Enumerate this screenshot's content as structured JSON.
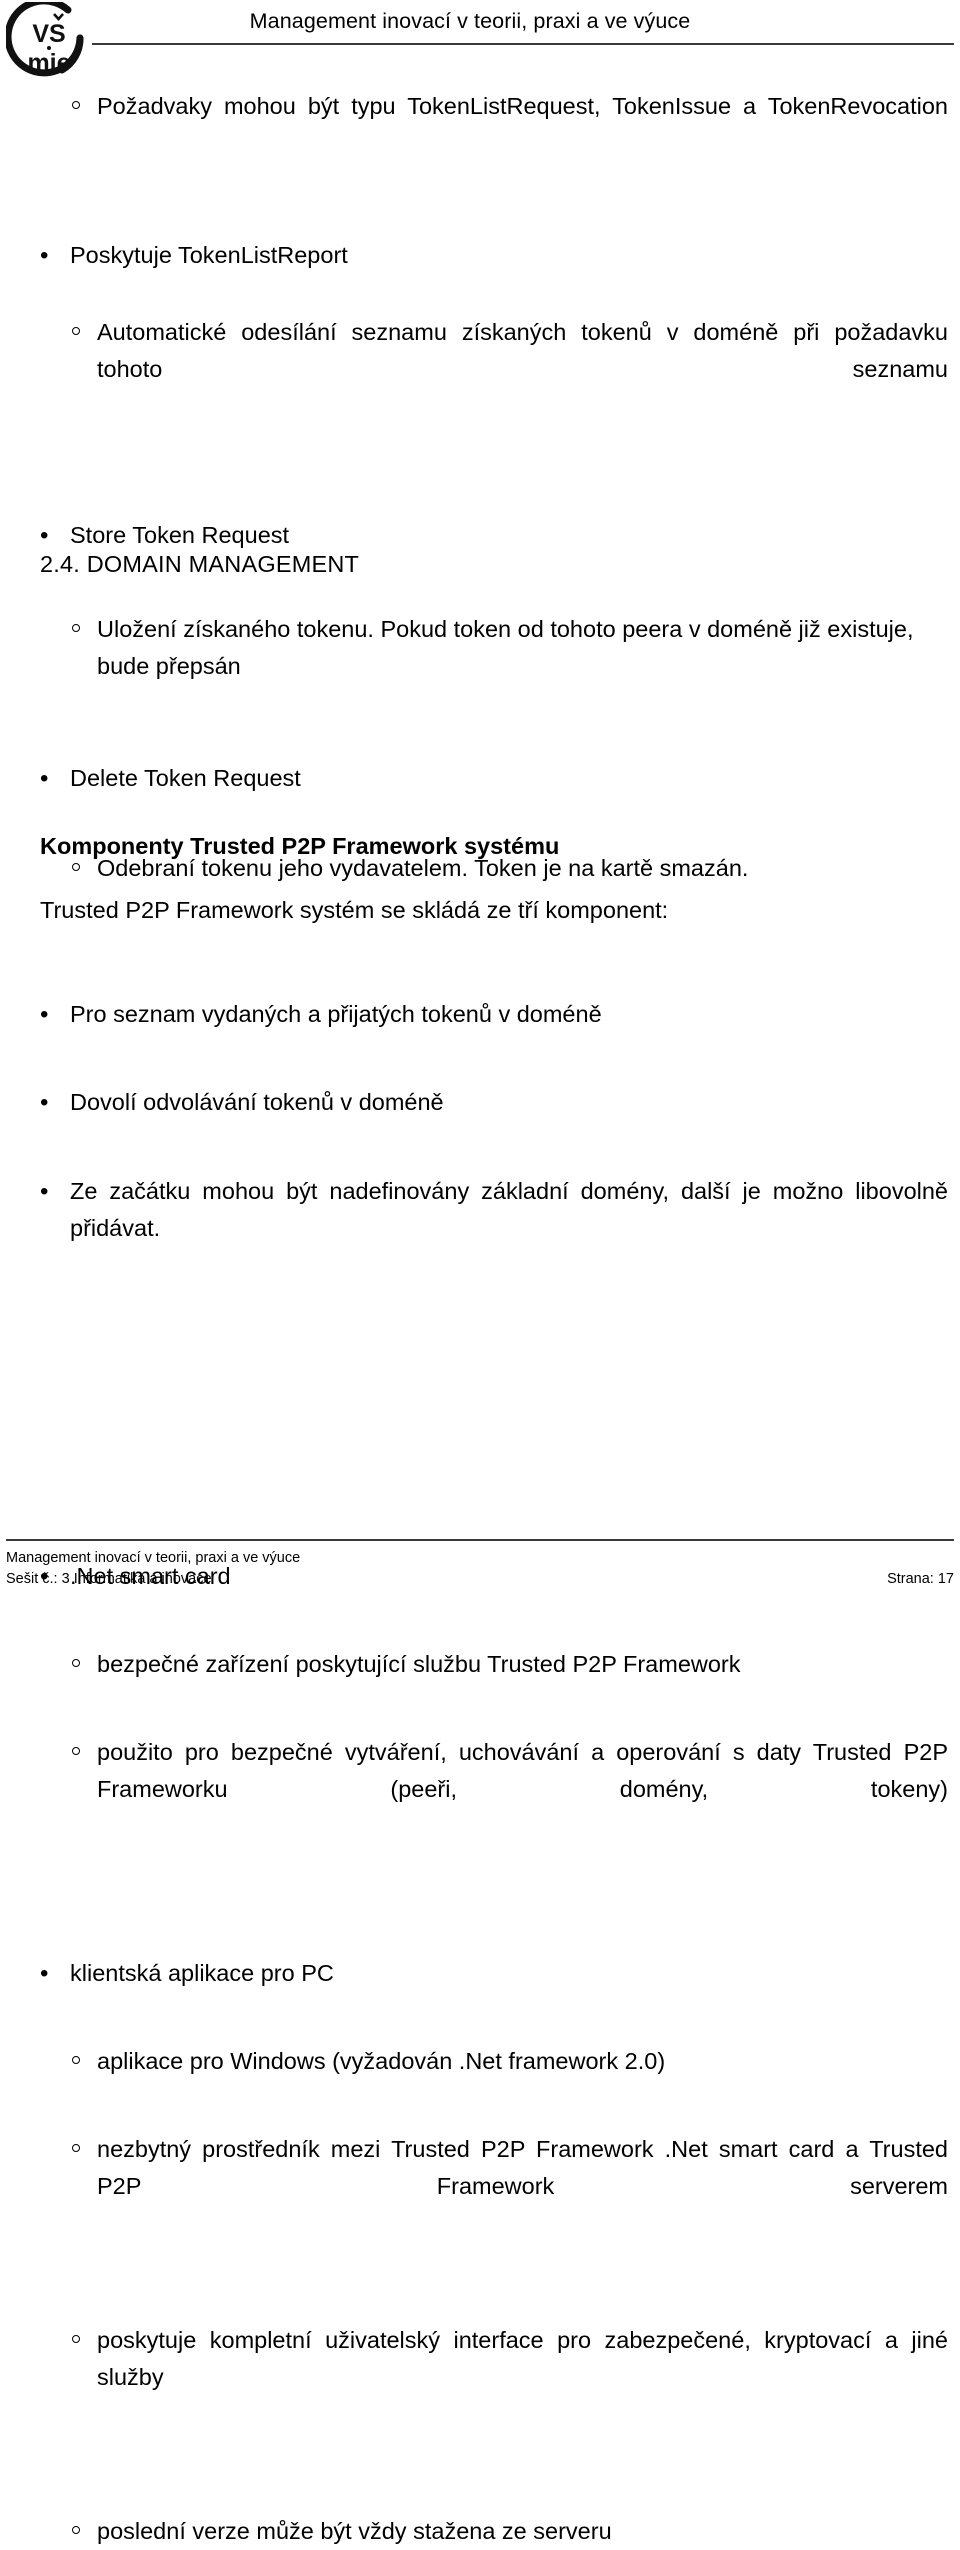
{
  "header": {
    "title": "Management inovací v teorii, praxi a ve výuce",
    "logo_line1": "VŠ",
    "logo_line2": "mie"
  },
  "body": {
    "b1": "Požadvaky mohou být typu TokenListRequest, TokenIssue a TokenRevocation",
    "b2": "Poskytuje TokenListReport",
    "b3": "Automatické odesílání seznamu získaných tokenů v doméně při požadavku tohoto seznamu",
    "b4": "Store Token Request",
    "b5": "Uložení získaného tokenu. Pokud token od tohoto peera v doméně již existuje, bude přepsán",
    "b6": "Delete Token Request",
    "b7": "Odebraní tokenu jeho vydavatelem. Token je na kartě smazán.",
    "section_heading": "2.4. DOMAIN MANAGEMENT",
    "b8": "Pro seznam vydaných a přijatých tokenů v doméně",
    "b9": "Dovolí odvolávání tokenů v doméně",
    "b10": "Ze začátku mohou být nadefinovány základní domény, další je možno libovolně přidávat.",
    "components_heading": "Komponenty Trusted P2P Framework systému",
    "components_intro": "Trusted P2P Framework systém se skládá ze tří komponent:",
    "b11": ".Net smart card",
    "b12": "bezpečné zařízení poskytující službu Trusted P2P Framework",
    "b13": "použito pro bezpečné vytváření, uchovávání a operování s daty Trusted P2P Frameworku (peeři, domény, tokeny)",
    "b14": "klientská aplikace pro PC",
    "b15": "aplikace pro Windows (vyžadován .Net framework 2.0)",
    "b16": "nezbytný prostředník mezi Trusted P2P Framework .Net smart card a Trusted P2P Framework serverem",
    "b17": "poskytuje kompletní uživatelský interface pro zabezpečené, kryptovací a jiné služby",
    "b18": "poslední verze může být vždy stažena ze serveru"
  },
  "markers": {
    "level1": "•",
    "level2": ""
  },
  "footer": {
    "line1": "Management inovací v teorii, praxi a ve výuce",
    "line2": "Sešit č.: 3 Informatika a inovace",
    "page": "Strana: 17"
  },
  "colors": {
    "text": "#000000",
    "rule": "#3a3a3a",
    "background": "#ffffff"
  }
}
